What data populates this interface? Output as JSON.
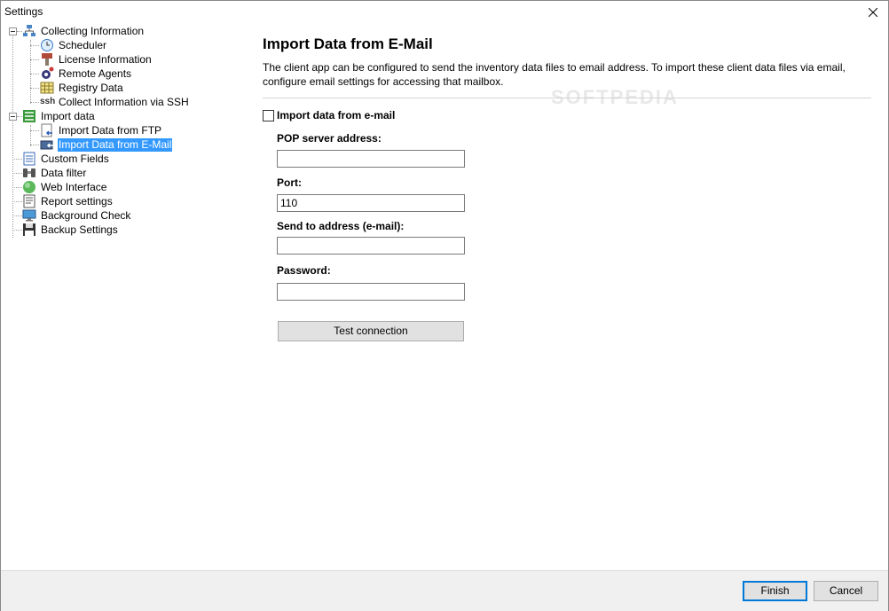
{
  "window": {
    "title": "Settings"
  },
  "tree": {
    "items": [
      {
        "label": "Collecting Information",
        "icon": "network-icon",
        "level": 0,
        "expanded": true
      },
      {
        "label": "Scheduler",
        "icon": "clock-icon",
        "level": 1
      },
      {
        "label": "License Information",
        "icon": "license-icon",
        "level": 1
      },
      {
        "label": "Remote Agents",
        "icon": "agents-icon",
        "level": 1
      },
      {
        "label": "Registry Data",
        "icon": "registry-icon",
        "level": 1
      },
      {
        "label": "Collect Information via SSH",
        "icon": "ssh-icon",
        "level": 1
      },
      {
        "label": "Import data",
        "icon": "import-icon",
        "level": 0,
        "expanded": true
      },
      {
        "label": "Import Data from FTP",
        "icon": "ftp-import-icon",
        "level": 1
      },
      {
        "label": "Import Data from E-Mail",
        "icon": "email-import-icon",
        "level": 1,
        "selected": true
      },
      {
        "label": "Custom Fields",
        "icon": "custom-fields-icon",
        "level": 0
      },
      {
        "label": "Data filter",
        "icon": "filter-icon",
        "level": 0
      },
      {
        "label": "Web Interface",
        "icon": "globe-icon",
        "level": 0
      },
      {
        "label": "Report settings",
        "icon": "report-icon",
        "level": 0
      },
      {
        "label": "Background Check",
        "icon": "monitor-icon",
        "level": 0
      },
      {
        "label": "Backup Settings",
        "icon": "floppy-icon",
        "level": 0
      }
    ],
    "ssh_icon_text": "ssh"
  },
  "main": {
    "heading": "Import Data from E-Mail",
    "description": "The client app can be configured to send the inventory data files to email address. To import these client data files via email, configure email settings for accessing that mailbox.",
    "enable_label": "Import data from e-mail",
    "enable_checked": false,
    "pop_label": "POP server address:",
    "pop_value": "",
    "port_label": "Port:",
    "port_value": "110",
    "send_to_label": "Send to address (e-mail):",
    "send_to_value": "",
    "password_label": "Password:",
    "password_value": "",
    "test_button": "Test connection"
  },
  "footer": {
    "finish": "Finish",
    "cancel": "Cancel"
  },
  "watermark": "SOFTPEDIA",
  "colors": {
    "selection": "#3399ff",
    "accent": "#0078d7",
    "footer_bg": "#f0f0f0"
  }
}
